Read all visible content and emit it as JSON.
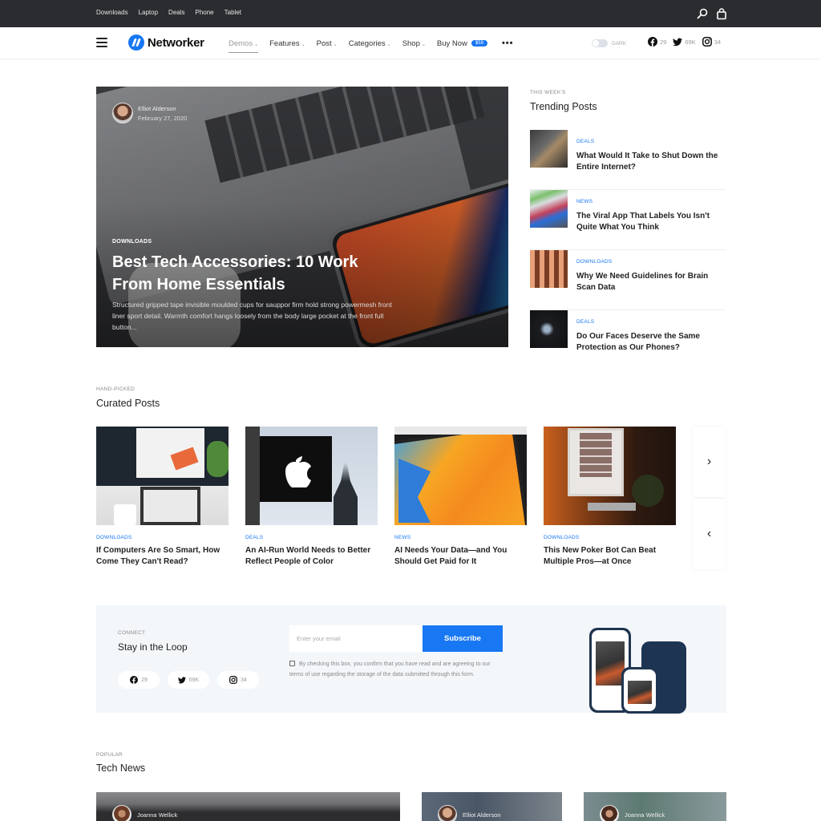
{
  "topbar": {
    "links": [
      "Downloads",
      "Laptop",
      "Deals",
      "Phone",
      "Tablet"
    ],
    "icons": [
      "search-icon",
      "shopping-bag-icon"
    ]
  },
  "nav": {
    "logo": "Networker",
    "menu": [
      {
        "label": "Demos",
        "has_dropdown": true,
        "active": true
      },
      {
        "label": "Features",
        "has_dropdown": true
      },
      {
        "label": "Post",
        "has_dropdown": true
      },
      {
        "label": "Categories",
        "has_dropdown": true
      },
      {
        "label": "Shop",
        "has_dropdown": true
      },
      {
        "label": "Buy Now",
        "badge": "$59"
      }
    ],
    "more": "•••",
    "dark_toggle_label": "DARK",
    "dark_mode_on": false,
    "socials": [
      {
        "icon": "facebook-icon",
        "count": "29"
      },
      {
        "icon": "twitter-icon",
        "count": "69K"
      },
      {
        "icon": "instagram-icon",
        "count": "34"
      }
    ]
  },
  "hero": {
    "author": "Elliot Alderson",
    "date": "February 27, 2020",
    "category": "DOWNLOADS",
    "title": "Best Tech Accessories: 10 Work From Home Essentials",
    "excerpt": "Structured gripped tape invisible moulded cups for sauppor firm hold strong powermesh front liner sport detail. Warmth comfort hangs loosely from the body large pocket at the front full button..."
  },
  "trending": {
    "eyebrow": "THIS WEEK'S",
    "title": "Trending Posts",
    "items": [
      {
        "category": "DEALS",
        "title": "What Would It Take to Shut Down the Entire Internet?"
      },
      {
        "category": "NEWS",
        "title": "The Viral App That Labels You Isn't Quite What You Think"
      },
      {
        "category": "DOWNLOADS",
        "title": "Why We Need Guidelines for Brain Scan Data"
      },
      {
        "category": "DEALS",
        "title": "Do Our Faces Deserve the Same Protection as Our Phones?"
      }
    ]
  },
  "curated": {
    "eyebrow": "HAND-PICKED",
    "title": "Curated Posts",
    "items": [
      {
        "category": "DOWNLOADS",
        "title": "If Computers Are So Smart, How Come They Can't Read?"
      },
      {
        "category": "DEALS",
        "title": "An AI-Run World Needs to Better Reflect People of Color"
      },
      {
        "category": "NEWS",
        "title": "AI Needs Your Data—and You Should Get Paid for It"
      },
      {
        "category": "DOWNLOADS",
        "title": "This New Poker Bot Can Beat Multiple Pros—at Once"
      }
    ],
    "next_arrow": "›",
    "prev_arrow": "‹"
  },
  "newsletter": {
    "eyebrow": "CONNECT",
    "title": "Stay in the Loop",
    "socials": [
      {
        "icon": "facebook-icon",
        "count": "29"
      },
      {
        "icon": "twitter-icon",
        "count": "69K"
      },
      {
        "icon": "instagram-icon",
        "count": "34"
      }
    ],
    "email_placeholder": "Enter your email",
    "email_value": "",
    "subscribe_label": "Subscribe",
    "consent_checked": false,
    "consent_text": "By checking this box, you confirm that you have read and are agreeing to our terms of use regarding the storage of the data submitted through this form."
  },
  "tech_news": {
    "eyebrow": "POPULAR",
    "title": "Tech News",
    "items": [
      {
        "author": "Joanna Wellick"
      },
      {
        "author": "Elliot Alderson"
      },
      {
        "author": "Joanna Wellick"
      }
    ]
  },
  "colors": {
    "accent": "#1877f2",
    "topbar_bg": "#2a2c30",
    "newsletter_bg": "#f4f7fa"
  }
}
